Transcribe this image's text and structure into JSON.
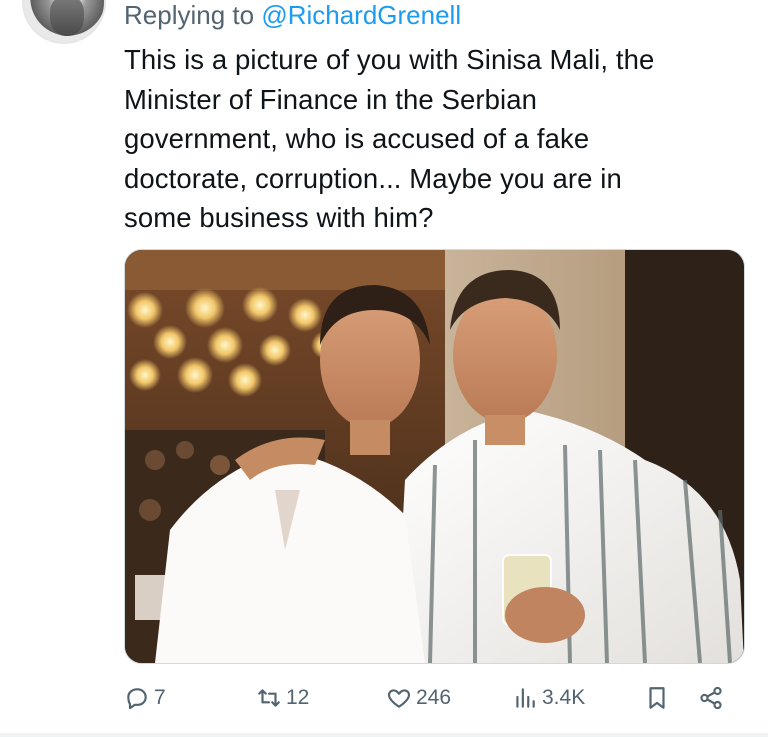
{
  "reply": {
    "prefix": "Replying to ",
    "handle": "@RichardGrenell"
  },
  "tweet": {
    "lines": [
      "This is a picture of you with Sinisa Mali, the",
      "Minister of Finance in the Serbian",
      "government, who is accused of a fake",
      "doctorate, corruption... Maybe you are in",
      "some business with him?"
    ]
  },
  "actions": {
    "reply_count": "7",
    "retweet_count": "12",
    "like_count": "246",
    "view_count": "3.4K",
    "icons": [
      "reply-icon",
      "retweet-icon",
      "like-icon",
      "views-icon",
      "bookmark-icon",
      "share-icon"
    ]
  },
  "colors": {
    "text": "#0f1419",
    "muted": "#536471",
    "accent": "#1d9bf0"
  }
}
